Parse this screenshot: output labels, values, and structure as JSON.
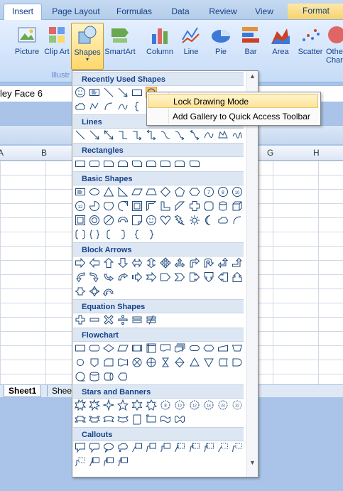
{
  "ribbon_tabs": [
    "Insert",
    "Page Layout",
    "Formulas",
    "Data",
    "Review",
    "View",
    "Format"
  ],
  "ribbon_buttons": {
    "picture": "Picture",
    "clipart": "Clip Art",
    "shapes": "Shapes",
    "smartart": "SmartArt",
    "column": "Column",
    "line": "Line",
    "pie": "Pie",
    "bar": "Bar",
    "area": "Area",
    "scatter": "Scatter",
    "other": "Othe Char"
  },
  "group_label": "Illustr",
  "namebox": "ley Face 6",
  "columns": [
    "A",
    "B",
    "G",
    "H"
  ],
  "sheets": [
    "Sheet1",
    "Shee"
  ],
  "dropdown": {
    "sections": [
      "Recently Used Shapes",
      "Lines",
      "Rectangles",
      "Basic Shapes",
      "Block Arrows",
      "Equation Shapes",
      "Flowchart",
      "Stars and Banners",
      "Callouts"
    ]
  },
  "context_menu": {
    "lock": "Lock Drawing Mode",
    "add": "Add Gallery to Quick Access Toolbar"
  }
}
